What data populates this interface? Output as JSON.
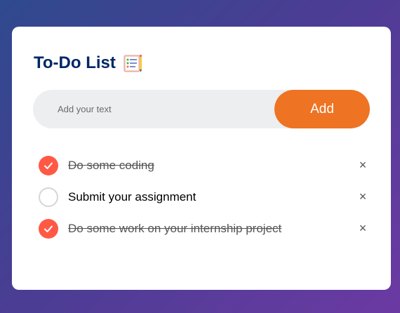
{
  "app": {
    "title": "To-Do List",
    "title_icon": "notepad-icon"
  },
  "input": {
    "placeholder": "Add your text",
    "value": ""
  },
  "add_button": {
    "label": "Add"
  },
  "colors": {
    "accent": "#ee7322",
    "check": "#ff5945",
    "title": "#002765"
  },
  "tasks": [
    {
      "text": "Do some coding",
      "done": true
    },
    {
      "text": "Submit your assignment",
      "done": false
    },
    {
      "text": "Do some work on your internship project",
      "done": true
    }
  ],
  "delete_glyph": "×"
}
